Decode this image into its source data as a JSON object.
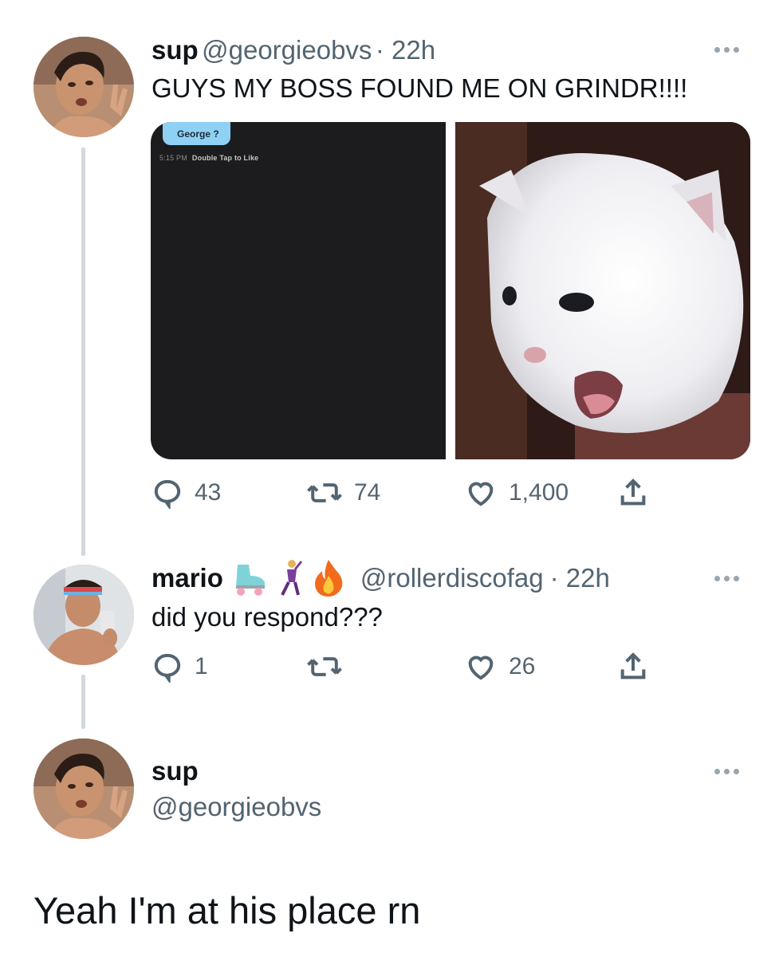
{
  "tweet1": {
    "name": "sup",
    "handle": "@georgieobvs",
    "time": "· 22h",
    "text": "GUYS MY BOSS FOUND ME ON GRINDR!!!!",
    "media_left": {
      "bubble_text": "George ?",
      "time": "5:15 PM",
      "hint": "Double Tap to Like"
    },
    "replies": "43",
    "retweets": "74",
    "likes": "1,400"
  },
  "tweet2": {
    "name": "mario",
    "handle": "@rollerdiscofag",
    "time": "· 22h",
    "text": "did you respond???",
    "replies": "1",
    "retweets": "",
    "likes": "26"
  },
  "tweet3": {
    "name": "sup",
    "handle": "@georgieobvs",
    "text": "Yeah I'm at his place rn"
  },
  "icons": [
    "more-icon",
    "reply-icon",
    "retweet-icon",
    "like-icon",
    "share-icon",
    "roller-skate-icon",
    "dancer-icon",
    "fire-icon"
  ],
  "colors": {
    "text": "#0f1419",
    "secondary": "#536471",
    "thread_line": "#cfd9de",
    "chat_bubble": "#8fd0f5"
  }
}
